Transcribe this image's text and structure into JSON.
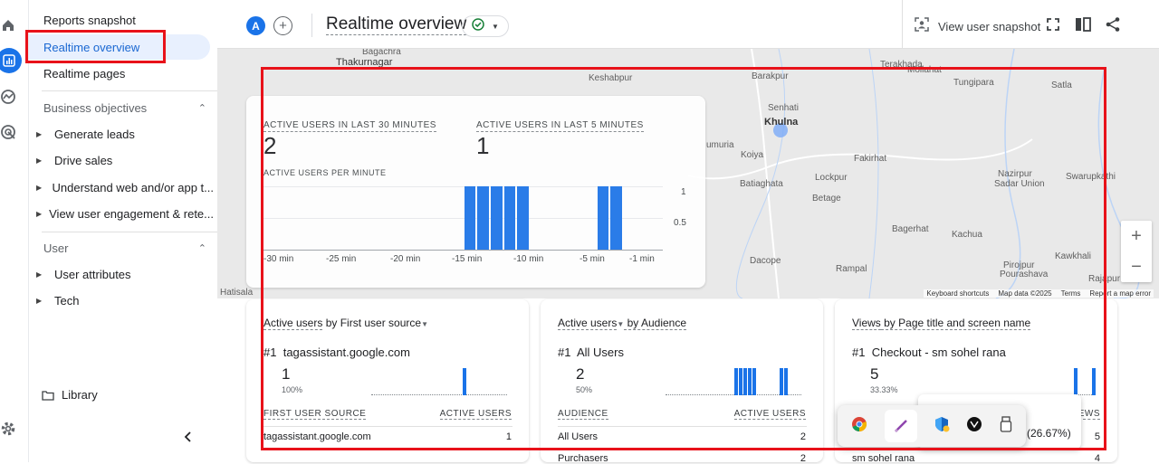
{
  "nav": {
    "reports_snapshot": "Reports snapshot",
    "realtime_overview": "Realtime overview",
    "realtime_pages": "Realtime pages",
    "business_objectives": "Business objectives",
    "business_items": [
      "Generate leads",
      "Drive sales",
      "Understand web and/or app t...",
      "View user engagement & rete..."
    ],
    "user_section": "User",
    "user_items": [
      "User attributes",
      "Tech"
    ],
    "library": "Library"
  },
  "topbar": {
    "avatar_letter": "A",
    "title": "Realtime overview",
    "view_user_snapshot": "View user snapshot"
  },
  "map": {
    "labels": [
      "Bagachra",
      "Thakurnagar",
      "Keshabpur",
      "Barakpur",
      "Terakhada",
      "Mollahat",
      "Tungipara",
      "Satla",
      "Khulna",
      "Senhati",
      "Fakirhat",
      "Koiya",
      "Batiaghata",
      "Lockpur",
      "Betage",
      "Nazirpur",
      "Sadar Union",
      "Swarupkathi",
      "Bagerhat",
      "Kachua",
      "Kawkhali",
      "Pirojpur",
      "Pourashava",
      "Rajapur",
      "Dacope",
      "Rampal",
      "Hatisala",
      "umuria"
    ],
    "attribution": [
      "Keyboard shortcuts",
      "Map data ©2025",
      "Terms",
      "Report a map error"
    ]
  },
  "summary": {
    "label_30": "ACTIVE USERS IN LAST 30 MINUTES",
    "value_30": "2",
    "label_5": "ACTIVE USERS IN LAST 5 MINUTES",
    "value_5": "1",
    "per_minute_label": "ACTIVE USERS PER MINUTE",
    "y_ticks": [
      "1",
      "0.5"
    ],
    "x_ticks": [
      "-30 min",
      "-25 min",
      "-20 min",
      "-15 min",
      "-10 min",
      "-5 min",
      "-1 min"
    ]
  },
  "chart_data": {
    "type": "bar",
    "x": [
      -30,
      -29,
      -28,
      -27,
      -26,
      -25,
      -24,
      -23,
      -22,
      -21,
      -20,
      -19,
      -18,
      -17,
      -16,
      -15,
      -14,
      -13,
      -12,
      -11,
      -10,
      -9,
      -8,
      -7,
      -6,
      -5,
      -4,
      -3,
      -2,
      -1
    ],
    "values": [
      0,
      0,
      0,
      0,
      0,
      0,
      0,
      0,
      0,
      0,
      0,
      0,
      0,
      0,
      0,
      1,
      1,
      1,
      1,
      1,
      0,
      0,
      0,
      0,
      0,
      1,
      1,
      0,
      0,
      0
    ],
    "title": "ACTIVE USERS PER MINUTE",
    "ylim": [
      0,
      1
    ]
  },
  "cards": [
    {
      "title_a": "Active users",
      "title_b": " by First user source",
      "rank": "#1",
      "top_name": "tagassistant.google.com",
      "top_value": "1",
      "top_pct": "100%",
      "col1": "FIRST USER SOURCE",
      "col2": "ACTIVE USERS",
      "rows": [
        [
          "tagassistant.google.com",
          "1"
        ]
      ],
      "spark": [
        0,
        0,
        0,
        0,
        0,
        0,
        0,
        0,
        0,
        0,
        0,
        0,
        0,
        0,
        0,
        0,
        0,
        0,
        0,
        0,
        1,
        0,
        0,
        0,
        0,
        0,
        0,
        0,
        0,
        0
      ]
    },
    {
      "title_a": "Active users",
      "title_b": " by Audience",
      "rank": "#1",
      "top_name": "All Users",
      "top_value": "2",
      "top_pct": "50%",
      "col1": "AUDIENCE",
      "col2": "ACTIVE USERS",
      "rows": [
        [
          "All Users",
          "2"
        ],
        [
          "Purchasers",
          "2"
        ]
      ],
      "spark": [
        0,
        0,
        0,
        0,
        0,
        0,
        0,
        0,
        0,
        0,
        0,
        0,
        0,
        0,
        0,
        1,
        1,
        1,
        1,
        1,
        0,
        0,
        0,
        0,
        0,
        1,
        1,
        0,
        0,
        0
      ]
    },
    {
      "title_a": "Views",
      "title_b": " by Page title and screen name",
      "rank": "#1",
      "top_name": "Checkout - sm sohel rana",
      "top_value": "5",
      "top_pct": "33.33%",
      "col2": "VIEWS",
      "rows": [
        [
          "",
          "5"
        ],
        [
          "sm sohel rana",
          "4"
        ]
      ],
      "spark": [
        0,
        0,
        0,
        0,
        0,
        0,
        0,
        0,
        0,
        0,
        0,
        0,
        0,
        0,
        0,
        0,
        0,
        0,
        0,
        0,
        0,
        0,
        0,
        0,
        0,
        1,
        0,
        0,
        0,
        1
      ]
    }
  ],
  "tray_tooltip": "4 (26.67%)",
  "colors": {
    "accent": "#1a73e8",
    "highlight": "#e8121a"
  }
}
